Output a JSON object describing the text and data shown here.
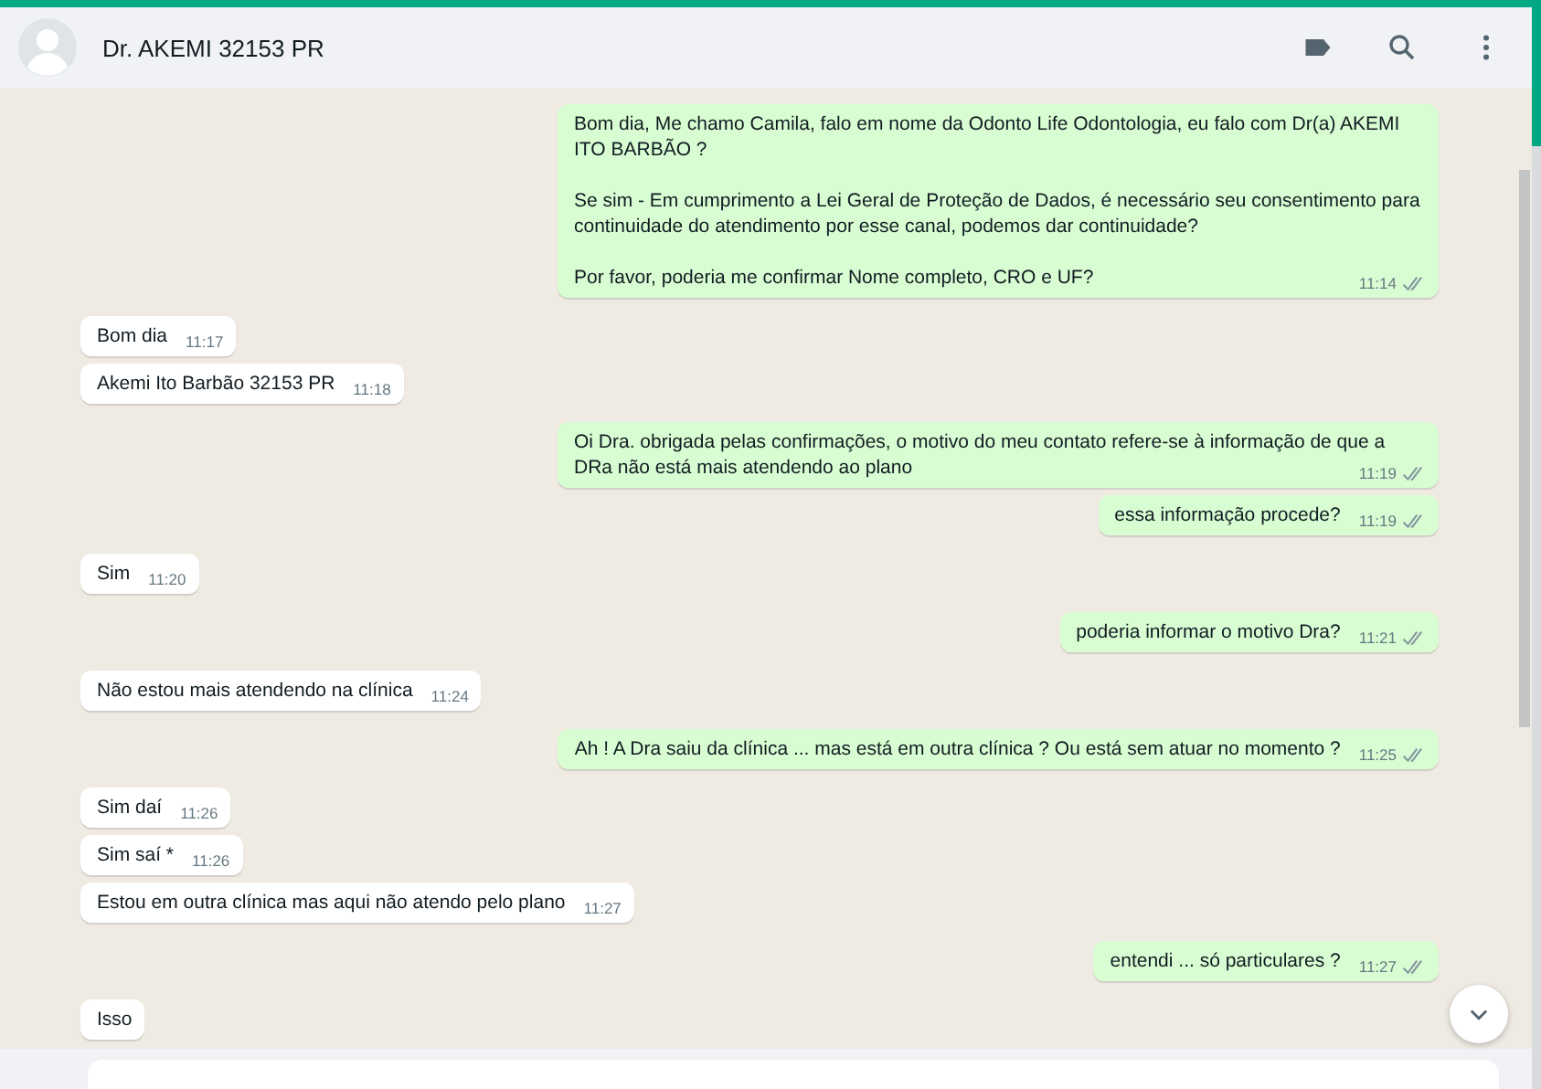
{
  "header": {
    "contact_name": "Dr. AKEMI 32153 PR"
  },
  "messages": [
    {
      "kind": "out",
      "paragraphs": [
        "Bom dia, Me chamo Camila, falo em nome da Odonto Life Odontologia, eu falo com Dr(a) AKEMI ITO BARBÃO  ?",
        "Se sim - Em cumprimento a Lei Geral de Proteção de Dados, é necessário seu consentimento para continuidade do atendimento por esse canal, podemos dar continuidade?",
        "Por favor, poderia me confirmar Nome completo, CRO e UF?"
      ],
      "time": "11:14",
      "read": false
    },
    {
      "kind": "in",
      "paragraphs": [
        "Bom dia"
      ],
      "time": "11:17"
    },
    {
      "kind": "in",
      "paragraphs": [
        "Akemi Ito Barbão 32153 PR"
      ],
      "time": "11:18"
    },
    {
      "kind": "out",
      "paragraphs": [
        "Oi Dra. obrigada pelas confirmações, o motivo do meu contato refere-se à informação de que a DRa não está mais atendendo ao plano"
      ],
      "time": "11:19",
      "read": false
    },
    {
      "kind": "out",
      "paragraphs": [
        "essa informação procede?"
      ],
      "time": "11:19",
      "read": false
    },
    {
      "kind": "in",
      "paragraphs": [
        "Sim"
      ],
      "time": "11:20"
    },
    {
      "kind": "out",
      "paragraphs": [
        "poderia informar o motivo Dra?"
      ],
      "time": "11:21",
      "read": false
    },
    {
      "kind": "in",
      "paragraphs": [
        "Não estou mais atendendo na clínica"
      ],
      "time": "11:24"
    },
    {
      "kind": "out",
      "paragraphs": [
        "Ah ! A Dra saiu da clínica ... mas está em outra clínica ? Ou está sem atuar no momento ?"
      ],
      "time": "11:25",
      "read": false
    },
    {
      "kind": "in",
      "paragraphs": [
        "Sim daí"
      ],
      "time": "11:26"
    },
    {
      "kind": "in",
      "paragraphs": [
        "Sim saí *"
      ],
      "time": "11:26"
    },
    {
      "kind": "in",
      "paragraphs": [
        "Estou em outra clínica mas aqui não atendo pelo plano"
      ],
      "time": "11:27"
    },
    {
      "kind": "out",
      "paragraphs": [
        "entendi ... só particulares ?"
      ],
      "time": "11:27",
      "read": false
    },
    {
      "kind": "in",
      "paragraphs": [
        "Isso"
      ]
    }
  ]
}
